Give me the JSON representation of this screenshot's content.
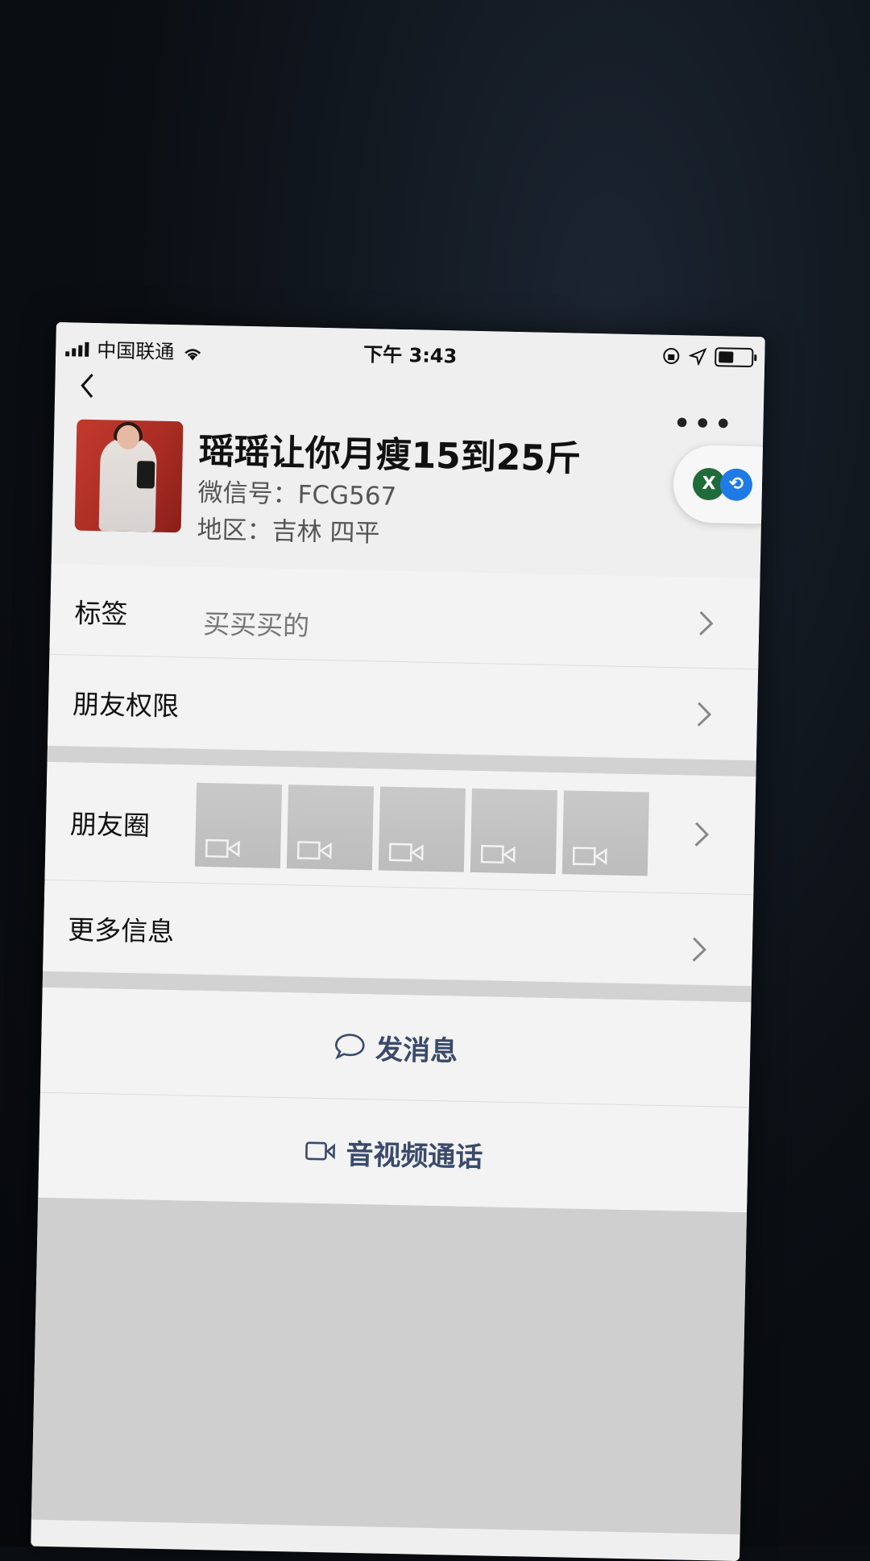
{
  "status_bar": {
    "carrier": "中国联通",
    "time": "下午 3:43"
  },
  "profile": {
    "name": "瑶瑶让你月瘦15到25斤",
    "wechat_id": "微信号：FCG567",
    "region": "地区：吉林 四平"
  },
  "rows": {
    "tags_label": "标签",
    "tags_value": "买买买的",
    "permissions_label": "朋友权限",
    "moments_label": "朋友圈",
    "more_info_label": "更多信息"
  },
  "actions": {
    "send_message": "发消息",
    "av_call": "音视频通话"
  },
  "float_pill": {
    "icon1_letter": "X"
  },
  "colors": {
    "action_text": "#3a4a6b",
    "page_bg": "#efefef",
    "avatar_bg": "#c23a2e"
  },
  "icons": [
    "back-icon",
    "more-icon",
    "wifi-icon",
    "signal-icon",
    "battery-icon",
    "location-icon",
    "lock-rotation-icon",
    "chevron-right-icon",
    "video-icon",
    "chat-bubble-icon",
    "video-call-icon"
  ]
}
